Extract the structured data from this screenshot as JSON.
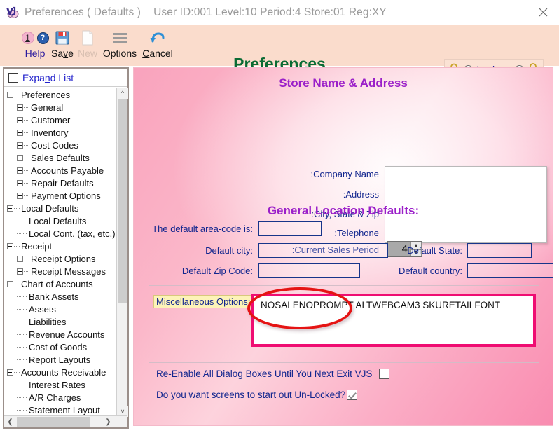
{
  "window": {
    "logo_icon": "vjs-logo-icon",
    "title": "Preferences ( Defaults )",
    "status": "User ID:001 Level:10 Period:4 Store:01 Reg:XY",
    "close_icon": "close-icon"
  },
  "toolbar": {
    "items": [
      {
        "label": "Help",
        "icon": "help-question-icon",
        "badge": "1",
        "disabled": false
      },
      {
        "label": "Save",
        "icon": "floppy-disk-save-icon",
        "disabled": false
      },
      {
        "label": "New",
        "icon": "new-page-icon",
        "disabled": true
      },
      {
        "label": "Options",
        "icon": "hamburger-menu-icon",
        "disabled": false
      },
      {
        "label": "Cancel",
        "icon": "undo-arrow-icon",
        "disabled": false
      }
    ],
    "heading": "Preferences",
    "heading_color": "#0a6b34",
    "lock": {
      "label": "Lock",
      "locked_icon": "padlock-closed-icon",
      "unlocked_icon": "padlock-open-icon",
      "locked_selected": false,
      "unlocked_selected": true
    }
  },
  "sidebar": {
    "expand_list": {
      "label": "Expand List",
      "checked": false
    },
    "scroll_up_icon": "chevron-up-icon",
    "scroll_down_icon": "chevron-down-icon",
    "scroll_left_icon": "chevron-left-icon",
    "scroll_right_icon": "chevron-right-icon",
    "tree": [
      {
        "label": "Preferences",
        "depth": 0,
        "toggle": "minus"
      },
      {
        "label": "General",
        "depth": 1,
        "toggle": "plus"
      },
      {
        "label": "Customer",
        "depth": 1,
        "toggle": "plus"
      },
      {
        "label": "Inventory",
        "depth": 1,
        "toggle": "plus"
      },
      {
        "label": "Cost Codes",
        "depth": 1,
        "toggle": "plus"
      },
      {
        "label": "Sales Defaults",
        "depth": 1,
        "toggle": "plus"
      },
      {
        "label": "Accounts Payable",
        "depth": 1,
        "toggle": "plus"
      },
      {
        "label": "Repair Defaults",
        "depth": 1,
        "toggle": "plus"
      },
      {
        "label": "Payment Options",
        "depth": 1,
        "toggle": "plus"
      },
      {
        "label": "Local Defaults",
        "depth": 0,
        "toggle": "minus"
      },
      {
        "label": "Local Defaults",
        "depth": 1,
        "toggle": "leaf"
      },
      {
        "label": "Local Cont. (tax, etc.)",
        "depth": 1,
        "toggle": "leaf"
      },
      {
        "label": "Receipt",
        "depth": 0,
        "toggle": "minus"
      },
      {
        "label": "Receipt Options",
        "depth": 1,
        "toggle": "plus"
      },
      {
        "label": "Receipt Messages",
        "depth": 1,
        "toggle": "plus"
      },
      {
        "label": "Chart of Accounts",
        "depth": 0,
        "toggle": "minus"
      },
      {
        "label": "Bank Assets",
        "depth": 1,
        "toggle": "leaf"
      },
      {
        "label": "Assets",
        "depth": 1,
        "toggle": "leaf"
      },
      {
        "label": "Liabilities",
        "depth": 1,
        "toggle": "leaf"
      },
      {
        "label": "Revenue Accounts",
        "depth": 1,
        "toggle": "leaf"
      },
      {
        "label": "Cost of Goods",
        "depth": 1,
        "toggle": "leaf"
      },
      {
        "label": "Report Layouts",
        "depth": 1,
        "toggle": "leaf"
      },
      {
        "label": "Accounts Receivable",
        "depth": 0,
        "toggle": "minus"
      },
      {
        "label": "Interest Rates",
        "depth": 1,
        "toggle": "leaf"
      },
      {
        "label": "A/R Charges",
        "depth": 1,
        "toggle": "leaf"
      },
      {
        "label": "Statement Layout",
        "depth": 1,
        "toggle": "leaf"
      }
    ]
  },
  "form": {
    "store_section_title": "Store Name & Address",
    "labels": {
      "company_name": ":Company Name",
      "address": ":Address",
      "city_state_zip": ":City, State & Zip",
      "telephone": ":Telephone",
      "current_sales_period": ":Current Sales Period"
    },
    "values": {
      "company_name": "",
      "address": "",
      "city_state_zip": "",
      "telephone": "",
      "current_sales_period": "4"
    },
    "general_section_title": "General Location Defaults:",
    "general": {
      "area_code_label": "The default area-code is:",
      "area_code_value": "",
      "city_label": "Default city:",
      "city_value": "",
      "state_label": "Default State:",
      "state_value": "",
      "zip_label": "Default Zip Code:",
      "zip_value": "",
      "country_label": "Default country:",
      "country_value": ""
    },
    "misc": {
      "label": "Miscellaneous Options:",
      "value": "NOSALENOPROMPT ALTWEBCAM3  SKURETAILFONT",
      "highlight_color": "#ef0d72",
      "annotation_color": "#e51414"
    },
    "checkboxes": [
      {
        "label": "Re-Enable All Dialog Boxes Until You Next Exit VJS",
        "checked": false
      },
      {
        "label": "Do you want screens to start out Un-Locked?",
        "checked": true
      }
    ]
  }
}
